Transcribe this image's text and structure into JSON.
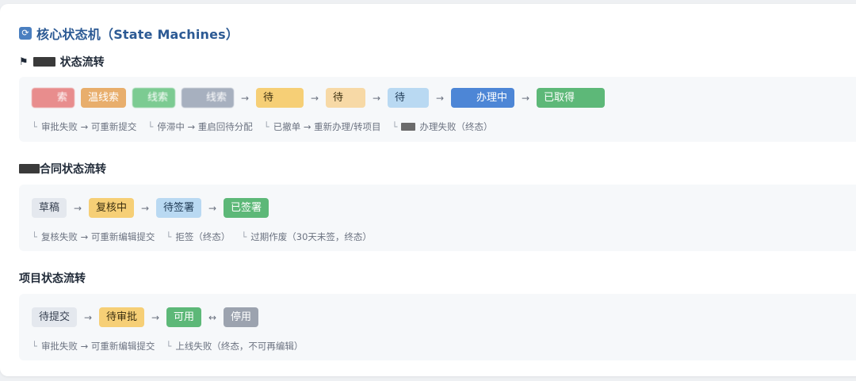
{
  "header": {
    "icon": "refresh-icon",
    "title": "核心状态机（State Machines）"
  },
  "sections": [
    {
      "title": "状态流转",
      "tags": [
        {
          "label": "索",
          "color": "#e88d8d"
        },
        {
          "label": "温线索",
          "color": "#e8ae6c"
        },
        {
          "label": "线索",
          "color": "#7ccb92"
        },
        {
          "label": "线索",
          "color": "#a7b0bf"
        },
        {
          "label": "待",
          "color": "#f6cf76"
        },
        {
          "label": "待",
          "color": "#f7d9a6"
        },
        {
          "label": "待",
          "color": "#b9d9f2"
        },
        {
          "label": "办理中",
          "color": "#4d86d6"
        },
        {
          "label": "已取得",
          "color": "#5db878"
        }
      ],
      "notes": [
        "审批失败 → 可重新提交",
        "停滞中 → 重启回待分配",
        "已撤单 → 重新办理/转项目",
        "办理失败（终态）"
      ]
    },
    {
      "title": "合同状态流转",
      "tags": [
        {
          "label": "草稿",
          "color": "#e4e8ee"
        },
        {
          "label": "复核中",
          "color": "#f6cf76"
        },
        {
          "label": "待签署",
          "color": "#b9d9f2"
        },
        {
          "label": "已签署",
          "color": "#5db878"
        }
      ],
      "notes": [
        "复核失败 → 可重新编辑提交",
        "拒签（终态）",
        "过期作废（30天未签，终态）"
      ]
    },
    {
      "title": "项目状态流转",
      "tags": [
        {
          "label": "待提交",
          "color": "#e4e8ee"
        },
        {
          "label": "待审批",
          "color": "#f6cf76"
        },
        {
          "label": "可用",
          "color": "#5db878"
        },
        {
          "label": "停用",
          "color": "#9ca3af"
        }
      ],
      "notes": [
        "审批失败 → 可重新编辑提交",
        "上线失败（终态，不可再编辑）"
      ]
    }
  ],
  "arrows": {
    "forward": "→",
    "bidirectional": "↔"
  },
  "note_mark": "└"
}
